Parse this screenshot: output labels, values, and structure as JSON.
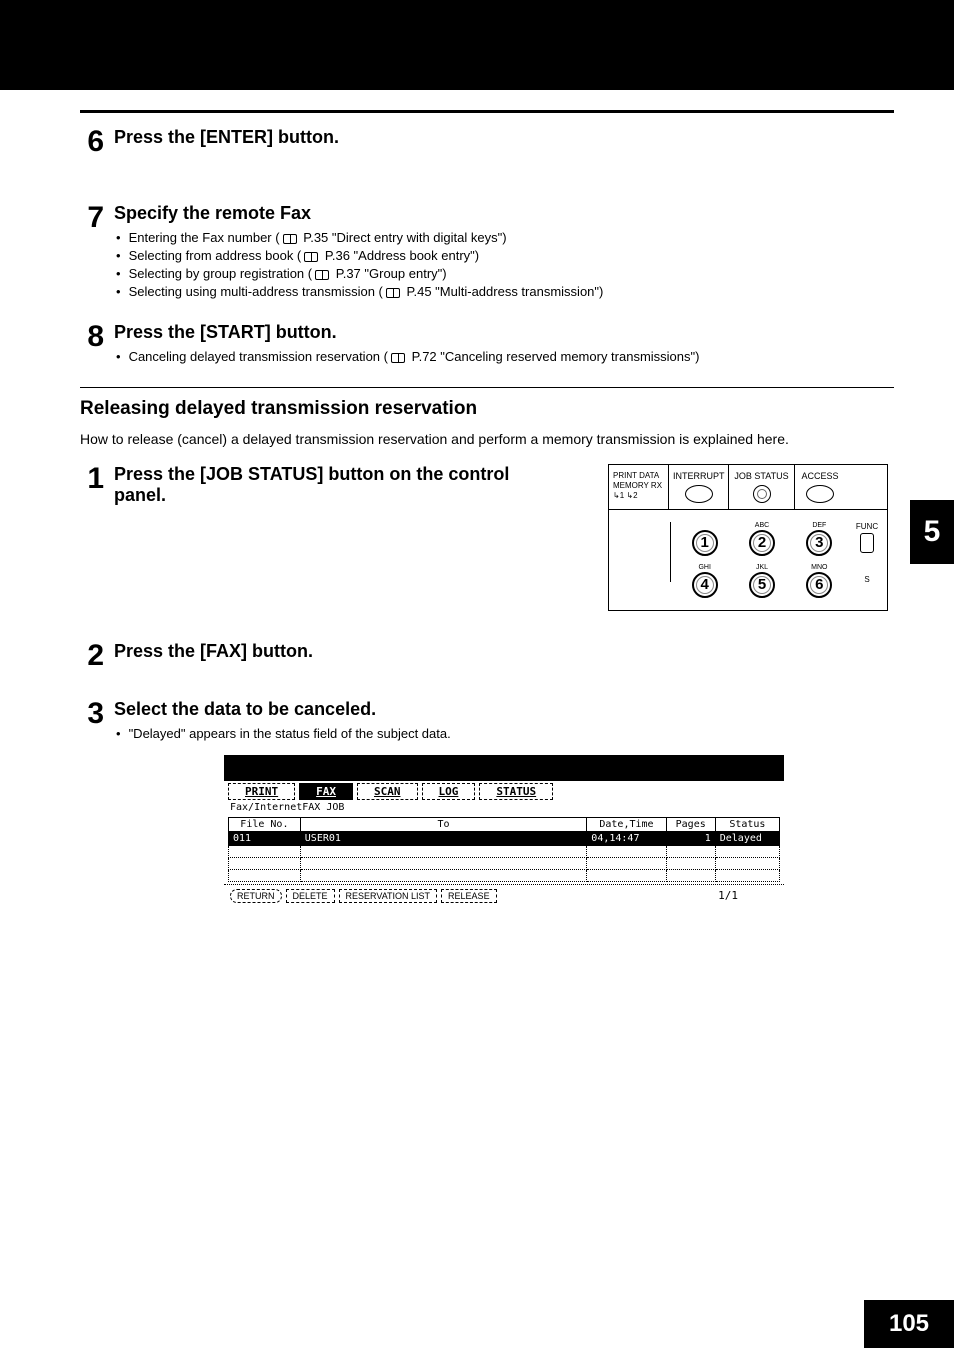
{
  "side_tab": "5",
  "page_number": "105",
  "steps_a": [
    {
      "num": "6",
      "title": "Press the [ENTER] button.",
      "bullets": []
    },
    {
      "num": "7",
      "title": "Specify the remote Fax",
      "bullets": [
        {
          "pre": "Entering the Fax number (",
          "ref": "P.35 \"Direct entry with digital keys\")"
        },
        {
          "pre": "Selecting from address book (",
          "ref": "P.36 \"Address book entry\")"
        },
        {
          "pre": "Selecting by group registration (",
          "ref": "P.37 \"Group entry\")"
        },
        {
          "pre": "Selecting using multi-address transmission (",
          "ref": "P.45 \"Multi-address transmission\")"
        }
      ]
    },
    {
      "num": "8",
      "title": "Press the [START] button.",
      "bullets": [
        {
          "pre": "Canceling delayed transmission reservation (",
          "ref": "P.72 \"Canceling reserved memory transmissions\")"
        }
      ]
    }
  ],
  "section": {
    "title": "Releasing delayed transmission reservation",
    "desc": "How to release (cancel) a delayed transmission reservation and perform a memory transmission is explained here."
  },
  "steps_b": {
    "s1": {
      "num": "1",
      "title": "Press the [JOB STATUS] button on the control panel."
    },
    "s2": {
      "num": "2",
      "title": "Press the [FAX] button."
    },
    "s3": {
      "num": "3",
      "title": "Select the data to be canceled.",
      "note": "\"Delayed\" appears in the status field of the subject data."
    }
  },
  "panel": {
    "left_labels": "PRINT DATA\nMEMORY RX\n↳1  ↳2",
    "cols": [
      "INTERRUPT",
      "JOB STATUS",
      "ACCESS"
    ],
    "func": "FUNC",
    "s_label": "S",
    "keys": [
      {
        "lbl": "",
        "n": "1"
      },
      {
        "lbl": "ABC",
        "n": "2"
      },
      {
        "lbl": "DEF",
        "n": "3"
      },
      {
        "lbl": "GHI",
        "n": "4"
      },
      {
        "lbl": "JKL",
        "n": "5"
      },
      {
        "lbl": "MNO",
        "n": "6"
      }
    ]
  },
  "screen": {
    "tabs": [
      "PRINT",
      "FAX",
      "SCAN",
      "LOG",
      "STATUS"
    ],
    "selected_tab": 1,
    "subtitle": "Fax/InternetFAX JOB",
    "headers": [
      "File No.",
      "To",
      "Date,Time",
      "Pages",
      "Status"
    ],
    "row": {
      "file": "011",
      "to": "USER01",
      "dt": "04,14:47",
      "pages": "1",
      "status": "Delayed"
    },
    "buttons": [
      "RETURN",
      "DELETE",
      "RESERVATION LIST",
      "RELEASE"
    ],
    "page": "1/1"
  }
}
